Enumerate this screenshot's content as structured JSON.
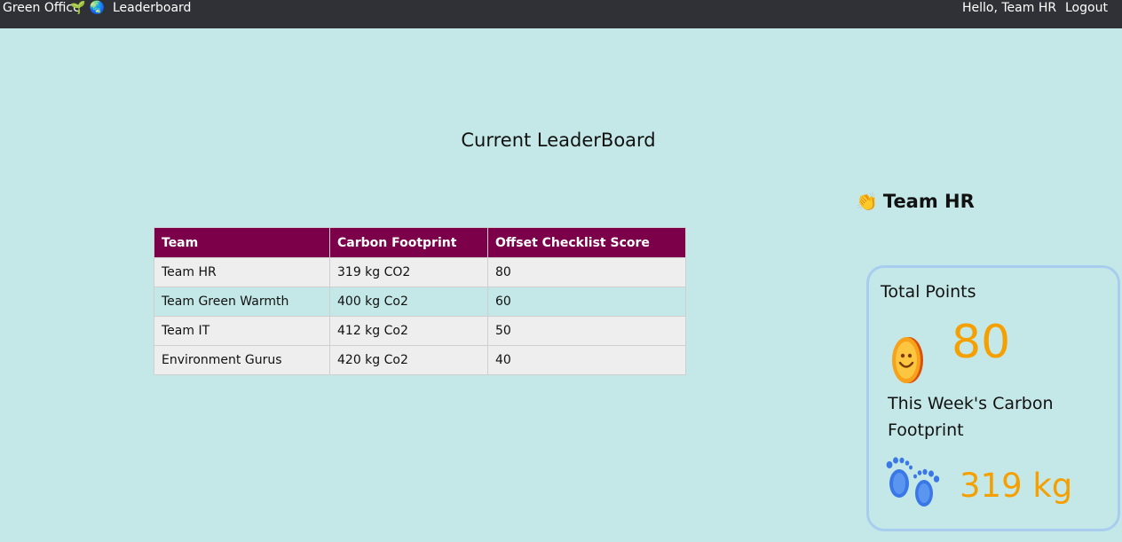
{
  "nav": {
    "brand": "Green Office",
    "brand_emoji": "🌱 🌏",
    "leaderboard_link": "Leaderboard",
    "greeting": "Hello, Team HR",
    "logout": "Logout"
  },
  "main": {
    "title": "Current LeaderBoard",
    "table": {
      "headers": [
        "Team",
        "Carbon Footprint",
        "Offset Checklist Score"
      ],
      "rows": [
        [
          "Team HR",
          "319 kg CO2",
          "80"
        ],
        [
          "Team Green Warmth",
          "400 kg Co2",
          "60"
        ],
        [
          "Team IT",
          "412 kg Co2",
          "50"
        ],
        [
          "Environment Gurus",
          "420 kg Co2",
          "40"
        ]
      ]
    }
  },
  "sidebar": {
    "wave_emoji": "👏",
    "team_name": "Team HR",
    "card": {
      "total_points_label": "Total Points",
      "total_points": "80",
      "coin_icon": "coin-icon",
      "carbon_label": "This Week's Carbon Footprint",
      "carbon_value": "319 kg",
      "footprints_icon": "footprints-icon"
    }
  },
  "colors": {
    "page_background": "#c4e8e7",
    "navbar": "#2f3136",
    "table_header": "#7b0049",
    "accent_value": "#f5a000",
    "card_border": "#a9cdee"
  }
}
